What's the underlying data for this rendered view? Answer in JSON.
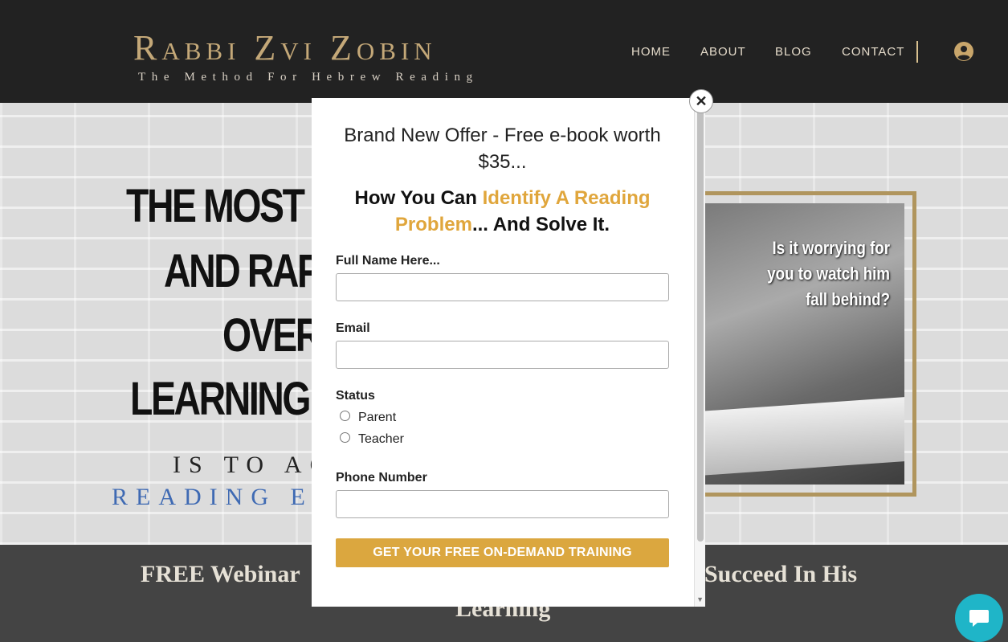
{
  "header": {
    "logo_title": "Rabbi Zvi Zobin",
    "logo_subtitle": "The Method For Hebrew Reading",
    "nav": [
      {
        "label": "HOME"
      },
      {
        "label": "ABOUT"
      },
      {
        "label": "BLOG"
      },
      {
        "label": "CONTACT"
      }
    ],
    "user_icon": "user-circle-icon"
  },
  "hero": {
    "lines": [
      "THE MOST DI",
      "AND RAPI",
      "OVERC",
      "LEARNING D"
    ],
    "sub_line1": "IS TO AC",
    "sub_line2": "READING EF",
    "image_caption": "Is it worrying for you to watch him fall behind?"
  },
  "band": {
    "left_text": "FREE Webinar",
    "right_text": "Succeed In His",
    "bottom_text": "Learning"
  },
  "modal": {
    "offer": "Brand New Offer - Free e-book worth $35...",
    "headline_pre": "How You Can ",
    "headline_gold": "Identify A Reading Problem",
    "headline_post": "... And Solve It.",
    "close_icon": "close-icon",
    "fields": {
      "name_label": "Full Name Here...",
      "email_label": "Email",
      "status_label": "Status",
      "status_options": [
        "Parent",
        "Teacher"
      ],
      "phone_label": "Phone Number"
    },
    "submit_label": "GET YOUR FREE ON-DEMAND TRAINING"
  },
  "chat_icon": "chat-bubble-icon",
  "colors": {
    "gold": "#e0a63c",
    "button": "#dba73f",
    "header_bg": "#222222",
    "chat": "#1fb5c8",
    "blue_text": "#3f6ab3"
  }
}
